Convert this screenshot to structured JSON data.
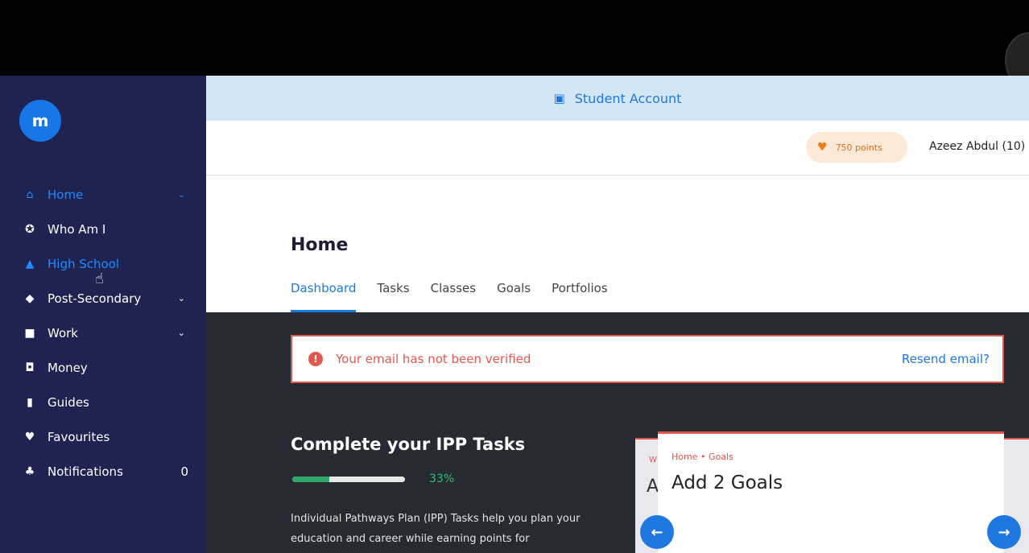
{
  "sidebar": {
    "logo": "m",
    "items": [
      {
        "label": "Home",
        "icon": "home-icon",
        "glyph": "⌂",
        "chevron": "⌄"
      },
      {
        "label": "Who Am I",
        "icon": "compass-icon",
        "glyph": "✪"
      },
      {
        "label": "High School",
        "icon": "school-icon",
        "glyph": "▲"
      },
      {
        "label": "Post-Secondary",
        "icon": "graduation-cap-icon",
        "glyph": "◆",
        "chevron": "⌄"
      },
      {
        "label": "Work",
        "icon": "briefcase-icon",
        "glyph": "■",
        "chevron": "⌄"
      },
      {
        "label": "Money",
        "icon": "money-icon",
        "glyph": "◘"
      },
      {
        "label": "Guides",
        "icon": "book-icon",
        "glyph": "▮"
      },
      {
        "label": "Favourites",
        "icon": "heart-icon",
        "glyph": "♥"
      },
      {
        "label": "Notifications",
        "icon": "bell-icon",
        "glyph": "♣",
        "count": "0"
      }
    ],
    "cursor_glyph": "☝"
  },
  "banner": {
    "bus_glyph": "▣",
    "label": "Student Account"
  },
  "userbar": {
    "heart_glyph": "♥",
    "points": "750 points",
    "username": "Azeez Abdul (10)"
  },
  "page": {
    "title": "Home",
    "tabs": [
      "Dashboard",
      "Tasks",
      "Classes",
      "Goals",
      "Portfolios"
    ]
  },
  "alert": {
    "icon_glyph": "!",
    "message": "Your email has not been verified",
    "action": "Resend email?"
  },
  "ipp": {
    "title": "Complete your IPP Tasks",
    "progress_percent": 33,
    "progress_label": "33%",
    "description": "Individual Pathways Plan (IPP) Tasks help you plan your education and career while earning points for"
  },
  "card": {
    "back_letter": "A",
    "back_crumb": "W",
    "crumb": "Home • Goals",
    "title": "Add 2 Goals",
    "left_glyph": "←",
    "right_glyph": "→"
  },
  "colors": {
    "sidebar_bg": "#1f2352",
    "accent": "#1f78e0",
    "alert": "#e2574c",
    "progress": "#2ea86b"
  }
}
